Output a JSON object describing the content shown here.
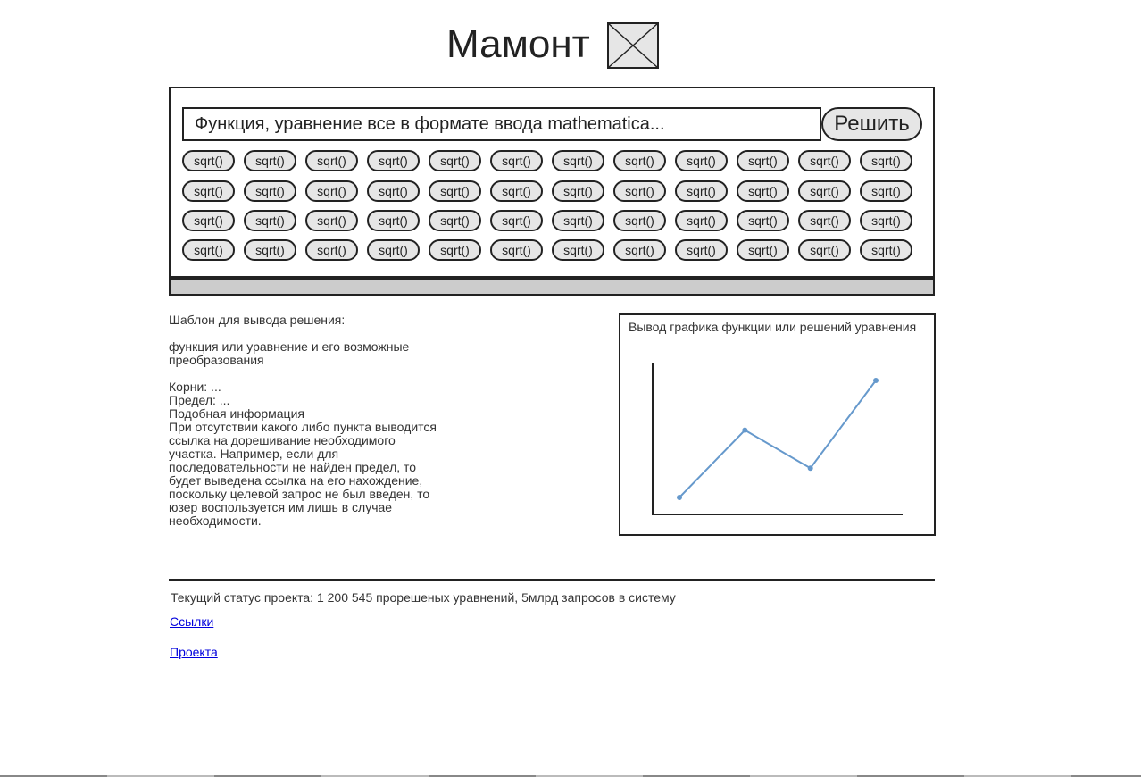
{
  "header": {
    "title": "Мамонт",
    "logo_icon": "image-placeholder-icon"
  },
  "search": {
    "placeholder": "Функция, уравнение все в формате ввода mathematica...",
    "solve_label": "Решить"
  },
  "functions": [
    "sqrt()",
    "sqrt()",
    "sqrt()",
    "sqrt()",
    "sqrt()",
    "sqrt()",
    "sqrt()",
    "sqrt()",
    "sqrt()",
    "sqrt()",
    "sqrt()",
    "sqrt()",
    "sqrt()",
    "sqrt()",
    "sqrt()",
    "sqrt()",
    "sqrt()",
    "sqrt()",
    "sqrt()",
    "sqrt()",
    "sqrt()",
    "sqrt()",
    "sqrt()",
    "sqrt()",
    "sqrt()",
    "sqrt()",
    "sqrt()",
    "sqrt()",
    "sqrt()",
    "sqrt()",
    "sqrt()",
    "sqrt()",
    "sqrt()",
    "sqrt()",
    "sqrt()",
    "sqrt()",
    "sqrt()",
    "sqrt()",
    "sqrt()",
    "sqrt()",
    "sqrt()",
    "sqrt()",
    "sqrt()",
    "sqrt()",
    "sqrt()",
    "sqrt()",
    "sqrt()",
    "sqrt()"
  ],
  "solution": {
    "heading": "Шаблон для вывода решения:",
    "transform": "функция или уравнение и его возможные преобразования",
    "roots": "Корни: ...",
    "limit": "Предел: ...",
    "similar": "Подобная информация",
    "note": "При отсутствии какого либо пункта выводится ссылка на дорешивание необходимого участка. Например, если для последовательности не найден предел, то будет выведена ссылка на его нахождение, поскольку целевой запрос не был введен, то юзер воспользуется им лишь в случае необходимости."
  },
  "graph": {
    "caption": "Вывод графика функции или решений уравнения",
    "line_color": "#6699cc",
    "points": [
      [
        1,
        1
      ],
      [
        2,
        3.3
      ],
      [
        3,
        2
      ],
      [
        4,
        5
      ]
    ]
  },
  "footer": {
    "status": "Текущий статус проекта: 1 200 545 прорешеных уравнений, 5млрд запросов в систему",
    "links": [
      "Ссылки",
      "Проекта"
    ]
  }
}
